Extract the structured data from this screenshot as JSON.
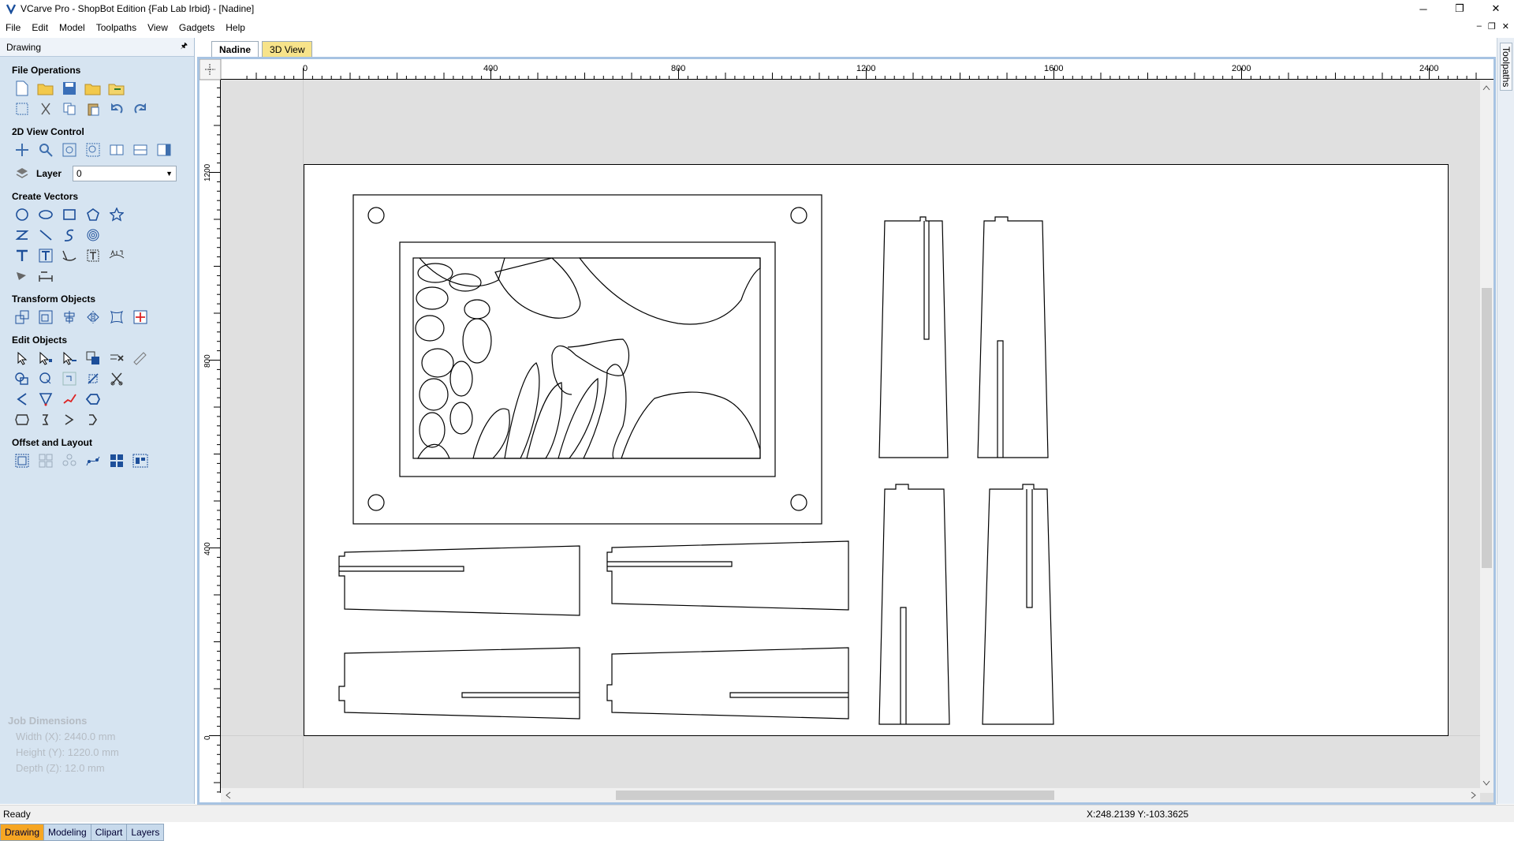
{
  "window": {
    "title": "VCarve Pro - ShopBot Edition {Fab Lab Irbid} - [Nadine]",
    "buttons": {
      "minimize": "─",
      "maximize": "❐",
      "close": "✕"
    }
  },
  "menu": {
    "items": [
      "File",
      "Edit",
      "Model",
      "Toolpaths",
      "View",
      "Gadgets",
      "Help"
    ],
    "mdi": [
      "–",
      "❐",
      "✕"
    ]
  },
  "sidebar": {
    "header": "Drawing",
    "pin": "🖈",
    "sections": {
      "file_operations": "File Operations",
      "view_control": "2D View Control",
      "create_vectors": "Create Vectors",
      "transform_objects": "Transform Objects",
      "edit_objects": "Edit Objects",
      "offset_layout": "Offset and Layout"
    },
    "layer": {
      "label": "Layer",
      "value": "0"
    }
  },
  "job_dimensions": {
    "title": "Job Dimensions",
    "width": "Width  (X): 2440.0 mm",
    "height": "Height (Y): 1220.0 mm",
    "depth": "Depth  (Z): 12.0 mm"
  },
  "bottom_tabs": [
    {
      "label": "Drawing",
      "active": true
    },
    {
      "label": "Modeling",
      "active": false
    },
    {
      "label": "Clipart",
      "active": false
    },
    {
      "label": "Layers",
      "active": false
    }
  ],
  "doc_tabs": [
    {
      "label": "Nadine",
      "active": true
    },
    {
      "label": "3D View",
      "active": false
    }
  ],
  "ruler": {
    "x_labels": [
      "0",
      "400",
      "800",
      "1200",
      "1600",
      "2000",
      "2400"
    ],
    "y_labels": [
      "1200",
      "800",
      "400",
      "0"
    ]
  },
  "right_panel": {
    "label": "Toolpaths"
  },
  "status": {
    "ready": "Ready",
    "coords": "X:248.2139 Y:-103.3625"
  },
  "colors": {
    "sidebar_bg": "#d6e4f1",
    "active_tab": "#f6a623",
    "canvas_bg": "#e0e0e0",
    "frame": "#a7c3e2"
  }
}
